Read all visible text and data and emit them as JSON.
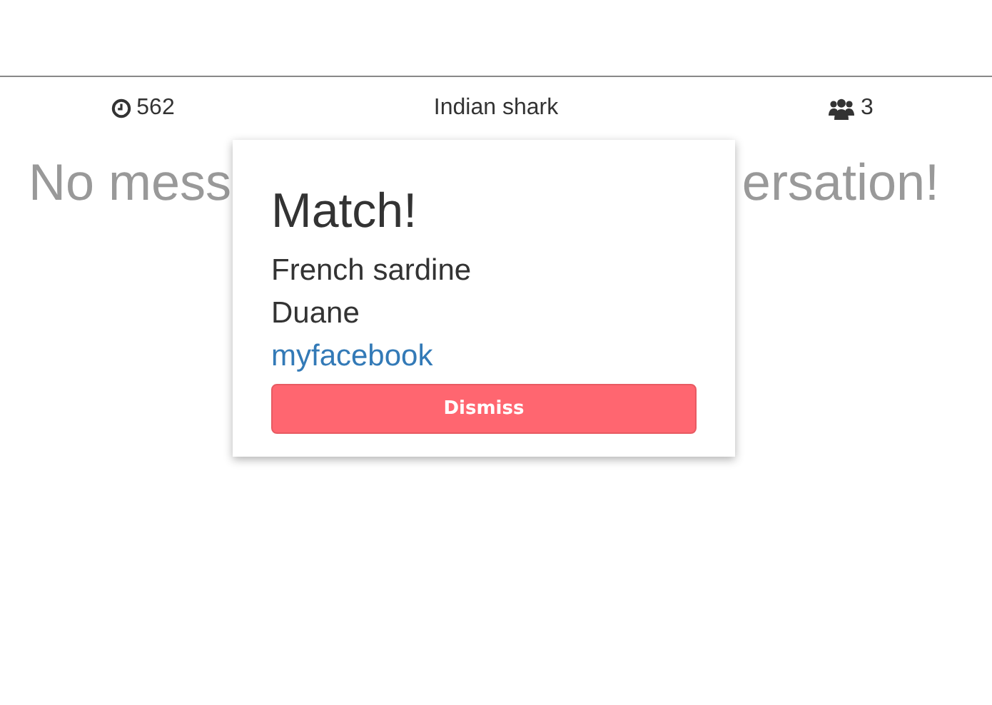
{
  "header": {
    "timer": "562",
    "title": "Indian shark",
    "members": "3"
  },
  "empty_message": {
    "visible_start": "No mess",
    "visible_end": "ersation!"
  },
  "modal": {
    "title": "Match!",
    "lines": [
      "French sardine",
      "Duane"
    ],
    "link": "myfacebook",
    "button": "Dismiss"
  }
}
